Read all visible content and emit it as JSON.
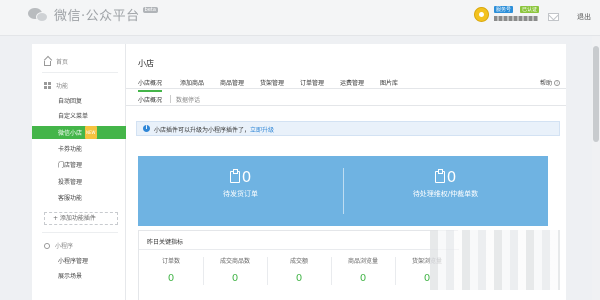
{
  "header": {
    "logo_text": "微信·公众平台",
    "beta": "beta",
    "badge_blue": "服务号",
    "badge_green": "已认证",
    "logout": "退出"
  },
  "sidebar": {
    "home": "首页",
    "function_section": "功能",
    "items": [
      {
        "label": "自动回复"
      },
      {
        "label": "自定义菜单"
      },
      {
        "label": "微信小店",
        "tag": "NEW"
      },
      {
        "label": "卡券功能"
      },
      {
        "label": "门店管理"
      },
      {
        "label": "投票管理"
      },
      {
        "label": "客服功能"
      }
    ],
    "add_plugin": "+ 添加功能插件",
    "miniprogram_section": "小程序",
    "mp_items": [
      {
        "label": "小程序管理"
      },
      {
        "label": "展示场景"
      }
    ]
  },
  "main": {
    "title": "小店",
    "tabs": [
      "小店概况",
      "添加商品",
      "商品管理",
      "货架管理",
      "订单管理",
      "运费管理",
      "图片库"
    ],
    "help": "帮助",
    "subtabs": [
      "小店概况",
      "数据停话"
    ],
    "notice_text": "小店插件可以升级为小程序插件了，",
    "notice_link": "立即升级",
    "stats": [
      {
        "value": "0",
        "label": "待发货订单"
      },
      {
        "value": "0",
        "label": "待处理维权/仲裁单数"
      }
    ],
    "kpi_title": "昨日关键指标",
    "kpis": [
      {
        "label": "订单数",
        "value": "0"
      },
      {
        "label": "成交商品数",
        "value": "0"
      },
      {
        "label": "成交额",
        "value": "0"
      },
      {
        "label": "商品浏览量",
        "value": "0"
      },
      {
        "label": "货架浏览量",
        "value": "0"
      }
    ]
  },
  "colors": {
    "accent_green": "#44b549",
    "panel_blue": "#6fb3e2",
    "link_blue": "#2f86d6"
  }
}
